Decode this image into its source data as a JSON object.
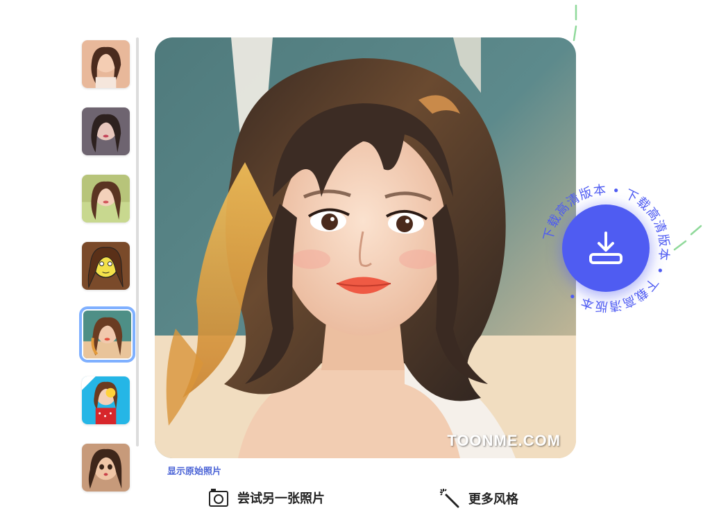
{
  "thumbnails": [
    {
      "name": "style-1",
      "selected": false
    },
    {
      "name": "style-2",
      "selected": false
    },
    {
      "name": "style-3",
      "selected": false
    },
    {
      "name": "style-4",
      "selected": false
    },
    {
      "name": "style-5",
      "selected": true
    },
    {
      "name": "style-6",
      "selected": false
    },
    {
      "name": "style-7",
      "selected": false
    }
  ],
  "main": {
    "watermark": "TOONME.COM",
    "show_original": "显示原始照片"
  },
  "actions": {
    "try_another": "尝试另一张照片",
    "more_styles": "更多风格"
  },
  "download": {
    "ring_text": "下载高清版本 • 下载高清版本 • 下载高清版本 • ",
    "icon": "download-icon"
  },
  "colors": {
    "accent": "#4f5cf2",
    "link": "#4a63d6",
    "selected_outline": "#7fb0ff",
    "deco_dash": "#8fd99a"
  }
}
